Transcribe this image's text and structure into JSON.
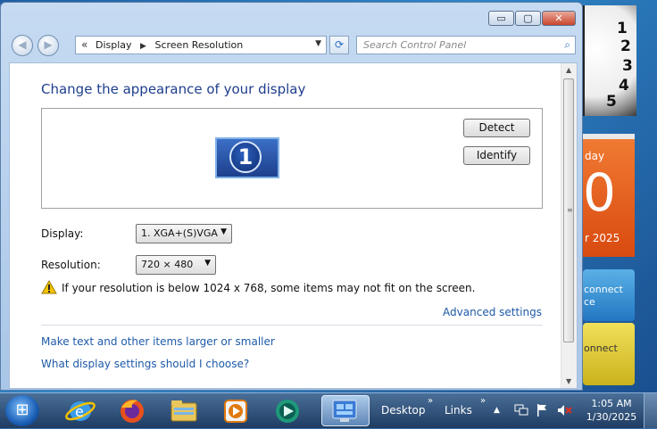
{
  "window": {
    "controls": {
      "min": "▭",
      "max": "▢",
      "close": "✕"
    },
    "nav": {
      "back": "◀",
      "forward": "▶"
    },
    "address": {
      "prefix": "«",
      "crumb1": "Display",
      "sep": "▶",
      "crumb2": "Screen Resolution",
      "dropdown": "▼"
    },
    "refresh": "⟳",
    "search": {
      "placeholder": "Search Control Panel",
      "icon": "⌕"
    }
  },
  "main": {
    "title": "Change the appearance of your display",
    "monitor_number": "1",
    "detect_label": "Detect",
    "identify_label": "Identify",
    "display_label": "Display:",
    "display_value": "1. XGA+(S)VGA",
    "resolution_label": "Resolution:",
    "resolution_value": "720 × 480",
    "warning_text": "If your resolution is below 1024 x 768, some items may not fit on the screen.",
    "advanced_link": "Advanced settings",
    "link1": "Make text and other items larger or smaller",
    "link2": "What display settings should I choose?"
  },
  "gadgets": {
    "clock_numbers": [
      "1",
      "2",
      "3",
      "4",
      "5"
    ],
    "calendar_day": "day",
    "calendar_big": "0",
    "calendar_year": "r 2025",
    "connect1_line1": "connect",
    "connect1_line2": "ce",
    "connect2_line1": "onnect"
  },
  "taskbar": {
    "start_icon": "⊞",
    "apps": [
      "ie-icon",
      "firefox-icon",
      "explorer-icon",
      "media-player-icon",
      "media-center-icon",
      "control-panel-icon"
    ],
    "desktop_label": "Desktop",
    "links_label": "Links",
    "chevron": "»",
    "time": "1:05 AM",
    "date": "1/30/2025"
  },
  "colors": {
    "accent": "#1e5aa8",
    "title": "#1e3e8c",
    "calendar": "#e0551a"
  }
}
